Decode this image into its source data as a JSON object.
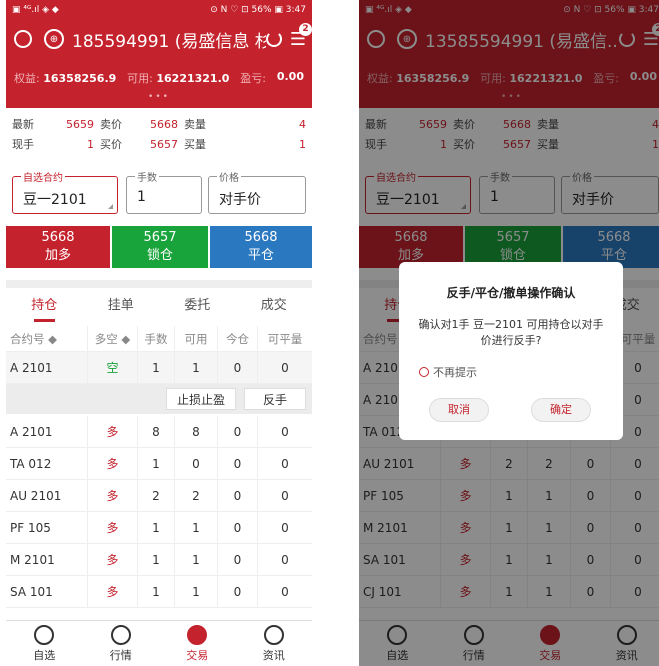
{
  "status": {
    "left": "▣ ⁴ᴳ.ıl ◈ ◆",
    "right": "⊙ N ♡ ⊡ 56% ▣ 3:47"
  },
  "header": {
    "account_left": "185594991 (易盛信息 杉",
    "account_right": "13585594991 (易盛信..",
    "badge": "2",
    "equity_label": "权益:",
    "equity_value": "16358256.9",
    "available_label": "可用:",
    "available_value": "16221321.0",
    "pnl_label": "盈亏:",
    "pnl_value": "0.00",
    "dots": "•••"
  },
  "quote": {
    "latest_label": "最新",
    "latest_value": "5659",
    "ask_label": "卖价",
    "ask_value": "5668",
    "ask_vol_label": "卖量",
    "ask_vol_value": "4",
    "cur_label": "现手",
    "cur_value": "1",
    "bid_label": "买价",
    "bid_value": "5657",
    "bid_vol_label": "买量",
    "bid_vol_value": "1"
  },
  "order": {
    "contract_label": "自选合约",
    "contract_value": "豆一2101",
    "qty_label": "手数",
    "qty_value": "1",
    "price_label": "价格",
    "price_value": "对手价"
  },
  "buttons": {
    "buy_price": "5668",
    "buy_label": "加多",
    "lock_price": "5657",
    "lock_label": "锁仓",
    "close_price": "5668",
    "close_label": "平仓"
  },
  "tabs": [
    "持仓",
    "挂单",
    "委托",
    "成交"
  ],
  "table": {
    "headers": [
      "合约号 ◆",
      "多空 ◆",
      "手数",
      "可用",
      "今仓",
      "可平量"
    ],
    "rows_left": [
      [
        "A 2101",
        "空",
        "1",
        "1",
        "0",
        "0"
      ],
      [
        "A 2101",
        "多",
        "8",
        "8",
        "0",
        "0"
      ],
      [
        "TA 012",
        "多",
        "1",
        "0",
        "0",
        "0"
      ],
      [
        "AU 2101",
        "多",
        "2",
        "2",
        "0",
        "0"
      ],
      [
        "PF 105",
        "多",
        "1",
        "1",
        "0",
        "0"
      ],
      [
        "M 2101",
        "多",
        "1",
        "1",
        "0",
        "0"
      ],
      [
        "SA 101",
        "多",
        "1",
        "1",
        "0",
        "0"
      ]
    ],
    "rows_right": [
      [
        "A 2101",
        "",
        "",
        "",
        "",
        "0"
      ],
      [
        "A 2101",
        "",
        "",
        "",
        "",
        "0"
      ],
      [
        "TA 012",
        "",
        "",
        "",
        "",
        "0"
      ],
      [
        "AU 2101",
        "多",
        "2",
        "2",
        "0",
        "0"
      ],
      [
        "PF 105",
        "多",
        "1",
        "1",
        "0",
        "0"
      ],
      [
        "M 2101",
        "多",
        "1",
        "1",
        "0",
        "0"
      ],
      [
        "SA 101",
        "多",
        "1",
        "1",
        "0",
        "0"
      ],
      [
        "CJ 101",
        "多",
        "1",
        "1",
        "0",
        "0"
      ]
    ]
  },
  "row_actions": {
    "stop": "止损止盈",
    "reverse": "反手"
  },
  "nav": [
    "自选",
    "行情",
    "交易",
    "资讯"
  ],
  "dialog": {
    "title": "反手/平仓/撤单操作确认",
    "message": "确认对1手 豆一2101 可用持仓以对手价进行反手?",
    "no_remind": "不再提示",
    "cancel": "取消",
    "confirm": "确定"
  },
  "colors": {
    "brand": "#c4232e",
    "green": "#19a33b",
    "blue": "#2a78c0"
  }
}
